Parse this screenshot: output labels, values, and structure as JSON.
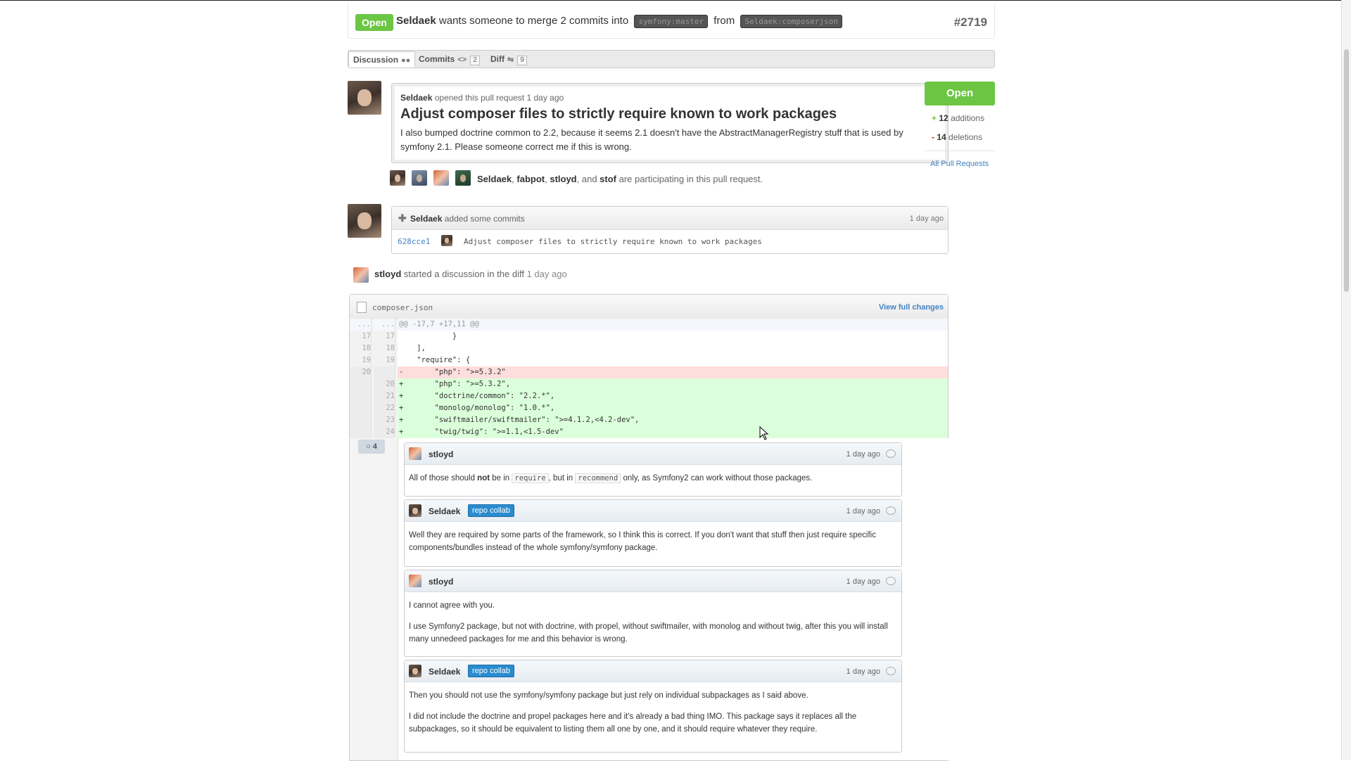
{
  "header": {
    "state": "Open",
    "author": "Seldaek",
    "text_wants": "wants someone to merge 2 commits into",
    "base_branch": "symfony:master",
    "text_from": "from",
    "head_branch": "Seldaek:composerjson",
    "number": "#2719"
  },
  "tabs": [
    {
      "label": "Discussion",
      "icon": "comments-icon"
    },
    {
      "label": "Commits",
      "icon": "code-icon",
      "count": "2"
    },
    {
      "label": "Diff",
      "icon": "diff-icon",
      "count": "9"
    }
  ],
  "opening": {
    "author": "Seldaek",
    "meta": "opened this pull request 1 day ago",
    "title": "Adjust composer files to strictly require known to work packages",
    "body": "I also bumped doctrine common to 2.2, because it seems 2.1 doesn't have the AbstractManagerRegistry stuff that is used by symfony 2.1. Please someone correct me if this is wrong."
  },
  "participants": {
    "names": [
      "Seldaek",
      "fabpot",
      "stloyd",
      "stof"
    ],
    "sep1": ", ",
    "sep2": ", ",
    "sep3": ", and ",
    "suffix": " are participating in this pull request."
  },
  "sidebar": {
    "state_button": "Open",
    "additions_count": "12",
    "additions_label": "additions",
    "deletions_count": "14",
    "deletions_label": "deletions",
    "all_prs": "All Pull Requests"
  },
  "commits": {
    "author": "Seldaek",
    "action": "added some commits",
    "time": "1 day ago",
    "sha": "628cce1",
    "message": "Adjust composer files to strictly require known to work packages"
  },
  "discussion": {
    "author": "stloyd",
    "action": "started a discussion in the diff",
    "time": "1 day ago",
    "file": "composer.json",
    "view_full": "View full changes",
    "comment_count": "4"
  },
  "diff_lines": [
    {
      "type": "hunk",
      "old": "...",
      "new": "...",
      "code": "@@ -17,7 +17,11 @@"
    },
    {
      "type": "ctx",
      "old": "17",
      "new": "17",
      "code": "            }"
    },
    {
      "type": "ctx",
      "old": "18",
      "new": "18",
      "code": "    ],"
    },
    {
      "type": "ctx",
      "old": "19",
      "new": "19",
      "code": "    \"require\": {"
    },
    {
      "type": "del",
      "old": "20",
      "new": "",
      "code": "-       \"php\": \">=5.3.2\""
    },
    {
      "type": "add",
      "old": "",
      "new": "20",
      "code": "+       \"php\": \">=5.3.2\","
    },
    {
      "type": "add",
      "old": "",
      "new": "21",
      "code": "+       \"doctrine/common\": \"2.2.*\","
    },
    {
      "type": "add",
      "old": "",
      "new": "22",
      "code": "+       \"monolog/monolog\": \"1.0.*\","
    },
    {
      "type": "add",
      "old": "",
      "new": "23",
      "code": "+       \"swiftmailer/swiftmailer\": \">=4.1.2,<4.2-dev\","
    },
    {
      "type": "add",
      "old": "",
      "new": "24",
      "code": "+       \"twig/twig\": \">=1.1,<1.5-dev\""
    }
  ],
  "comments": [
    {
      "author": "stloyd",
      "time": "1 day ago",
      "badge": "",
      "body_a": "All of those should ",
      "body_b": "not",
      "body_c": " be in ",
      "code1": "require",
      "body_d": ", but in ",
      "code2": "recommend",
      "body_e": " only, as Symfony2 can work without those packages."
    },
    {
      "author": "Seldaek",
      "time": "1 day ago",
      "badge": "repo collab",
      "p1": "Well they are required by some parts of the framework, so I think this is correct. If you don't want that stuff then just require specific components/bundles instead of the whole symfony/symfony package."
    },
    {
      "author": "stloyd",
      "time": "1 day ago",
      "badge": "",
      "p1": "I cannot agree with you.",
      "p2": "I use Symfony2 package, but not with doctrine, with propel, without swiftmailer, with monolog and without twig, after this you will install many unnedeed packages for me and this behavior is wrong."
    },
    {
      "author": "Seldaek",
      "time": "1 day ago",
      "badge": "repo collab",
      "p1": "Then you should not use the symfony/symfony package but just rely on individual subpackages as I said above.",
      "p2": "I did not include the doctrine and propel packages here and it's already a bad thing IMO. This package says it replaces all the subpackages, so it should be equivalent to listing them all one by one, and it should require whatever they require."
    }
  ]
}
